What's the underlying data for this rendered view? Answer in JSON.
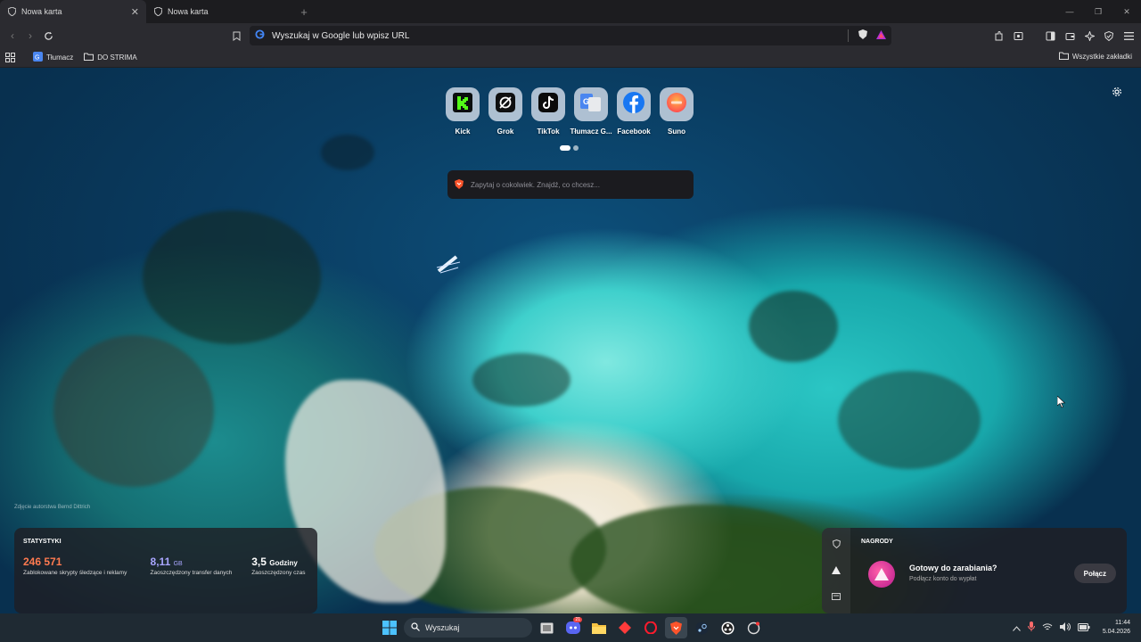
{
  "tabs": [
    {
      "label": "Nowa karta",
      "active": true
    },
    {
      "label": "Nowa karta",
      "active": false
    }
  ],
  "toolbar": {
    "omnibox_text": "Wyszukaj w Google lub wpisz URL"
  },
  "bookmarks": {
    "items": [
      {
        "label": "Tłumacz",
        "icon": "google-translate-icon"
      },
      {
        "label": "DO STRIMA",
        "icon": "folder-icon"
      }
    ],
    "all_label": "Wszystkie zakładki"
  },
  "top_sites": [
    {
      "label": "Kick",
      "icon": "kick-icon"
    },
    {
      "label": "Grok",
      "icon": "grok-icon"
    },
    {
      "label": "TikTok",
      "icon": "tiktok-icon"
    },
    {
      "label": "Tłumacz G...",
      "icon": "google-translate-icon"
    },
    {
      "label": "Facebook",
      "icon": "facebook-icon"
    },
    {
      "label": "Suno",
      "icon": "suno-icon"
    }
  ],
  "ask": {
    "placeholder": "Zapytaj o cokolwiek. Znajdź, co chcesz..."
  },
  "photo_credit": "Zdjęcie autorstwa Bernd Dittrich",
  "stats": {
    "title": "STATYSTYKI",
    "items": [
      {
        "value": "246 571",
        "unit": "",
        "desc": "Zablokowane skrypty śledzące i reklamy",
        "color": "#ff7a50"
      },
      {
        "value": "8,11",
        "unit": "GB",
        "desc": "Zaoszczędzony transfer danych",
        "color": "#a9a6ff"
      },
      {
        "value": "3,5",
        "unit": "Godziny",
        "desc": "Zaoszczędzony czas",
        "color": "#ffffff"
      }
    ]
  },
  "rewards": {
    "title": "NAGRODY",
    "heading": "Gotowy do zarabiania?",
    "subtitle": "Podłącz konto do wypłat",
    "button": "Połącz"
  },
  "taskbar": {
    "search_label": "Wyszukaj",
    "time": "11:44",
    "date": "5.04.2026",
    "discord_badge": "21"
  },
  "colors": {
    "brave_accent": "#fb542b",
    "kick_green": "#53fc18",
    "facebook_blue": "#1877f2"
  }
}
